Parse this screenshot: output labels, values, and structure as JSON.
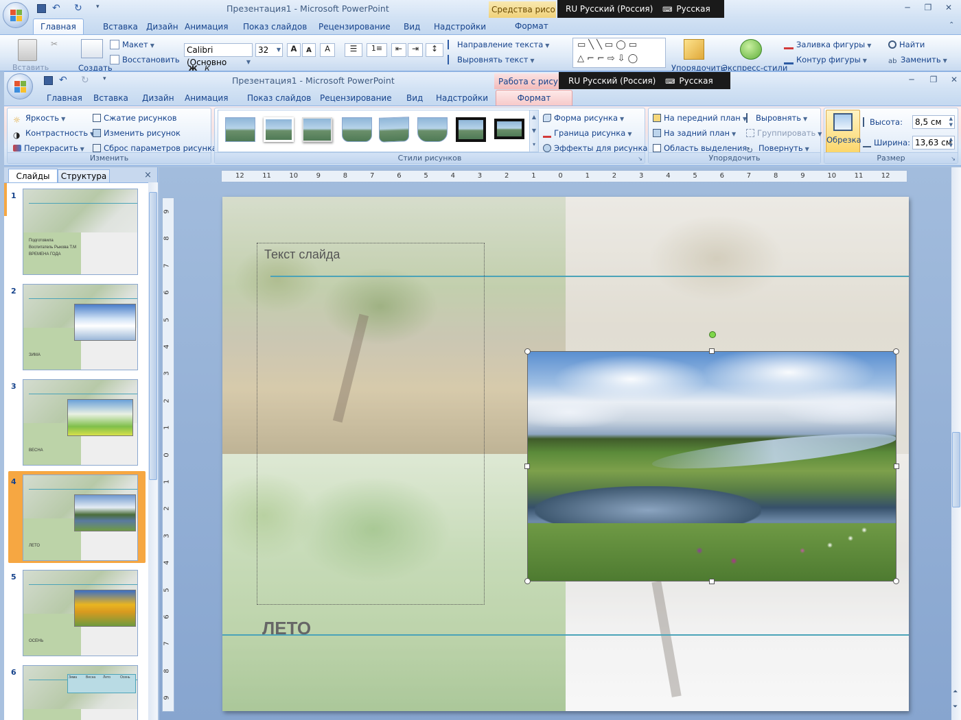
{
  "back_window": {
    "title": "Презентация1 - Microsoft PowerPoint",
    "context_tab": "Средства рисова",
    "tabs": [
      "Главная",
      "Вставка",
      "Дизайн",
      "Анимация",
      "Показ слайдов",
      "Рецензирование",
      "Вид",
      "Надстройки"
    ],
    "context_subtab": "Формат",
    "lang_bar": {
      "lang": "RU Русский (Россия)",
      "layout": "Русская"
    },
    "ribbon": {
      "paste": "Вставить",
      "create": "Создать",
      "layout": "Макет",
      "restore": "Восстановить",
      "font_name": "Calibri (Основно",
      "font_size": "32",
      "text_direction": "Направление текста",
      "align_text": "Выровнять текст",
      "arrange": "Упорядочить",
      "express_styles": "Экспресс-стили",
      "shape_fill": "Заливка фигуры",
      "shape_outline": "Контур фигуры",
      "find": "Найти",
      "replace": "Заменить"
    }
  },
  "window": {
    "title": "Презентация1 - Microsoft PowerPoint",
    "context_tab": "Работа с рисунк",
    "tabs": [
      "Главная",
      "Вставка",
      "Дизайн",
      "Анимация",
      "Показ слайдов",
      "Рецензирование",
      "Вид",
      "Надстройки"
    ],
    "active_context_tab": "Формат",
    "lang_bar": {
      "lang": "RU Русский (Россия)",
      "layout": "Русская"
    }
  },
  "ribbon": {
    "adjust": {
      "label": "Изменить",
      "brightness": "Яркость",
      "contrast": "Контрастность",
      "recolor": "Перекрасить",
      "compress": "Сжатие рисунков",
      "change_picture": "Изменить рисунок",
      "reset_picture": "Сброс параметров рисунка"
    },
    "styles": {
      "label": "Стили рисунков",
      "picture_shape": "Форма рисунка",
      "picture_border": "Граница рисунка",
      "picture_effects": "Эффекты для рисунка"
    },
    "arrange": {
      "label": "Упорядочить",
      "bring_front": "На передний план",
      "send_back": "На задний план",
      "selection_pane": "Область выделения",
      "align": "Выровнять",
      "group": "Группировать",
      "rotate": "Повернуть"
    },
    "size": {
      "label": "Размер",
      "crop": "Обрезка",
      "height_label": "Высота:",
      "height_value": "8,5 см",
      "width_label": "Ширина:",
      "width_value": "13,63 см"
    }
  },
  "panel": {
    "tab_slides": "Слайды",
    "tab_outline": "Структура",
    "close": "×",
    "slides": [
      {
        "num": "1",
        "lines": [
          "Подготовила",
          "Воспитатель Рыкова Т.М",
          "ВРЕМЕНА ГОДА"
        ]
      },
      {
        "num": "2",
        "lines": [
          "ЗИМА"
        ]
      },
      {
        "num": "3",
        "lines": [
          "ВЕСНА"
        ]
      },
      {
        "num": "4",
        "lines": [
          "ЛЕТО"
        ]
      },
      {
        "num": "5",
        "lines": [
          "ОСЕНЬ"
        ]
      },
      {
        "num": "6",
        "lines": [
          "Зима",
          "Весна",
          "Лето",
          "Осень"
        ]
      }
    ],
    "selected_slide": "4"
  },
  "ruler": {
    "h_ticks": [
      "12",
      "11",
      "10",
      "9",
      "8",
      "7",
      "6",
      "5",
      "4",
      "3",
      "2",
      "1",
      "0",
      "1",
      "2",
      "3",
      "4",
      "5",
      "6",
      "7",
      "8",
      "9",
      "10",
      "11",
      "12"
    ],
    "v_ticks": [
      "9",
      "8",
      "7",
      "6",
      "5",
      "4",
      "3",
      "2",
      "1",
      "0",
      "1",
      "2",
      "3",
      "4",
      "5",
      "6",
      "7",
      "8",
      "9"
    ]
  },
  "slide": {
    "text_placeholder": "Текст слайда",
    "title": "ЛЕТО"
  },
  "colors": {
    "ribbon_tab_text": "#15428b",
    "context_tab_pink": "#f7c1c1",
    "selected_slide": "#f6a742",
    "guide_line": "#4aa3b8"
  }
}
